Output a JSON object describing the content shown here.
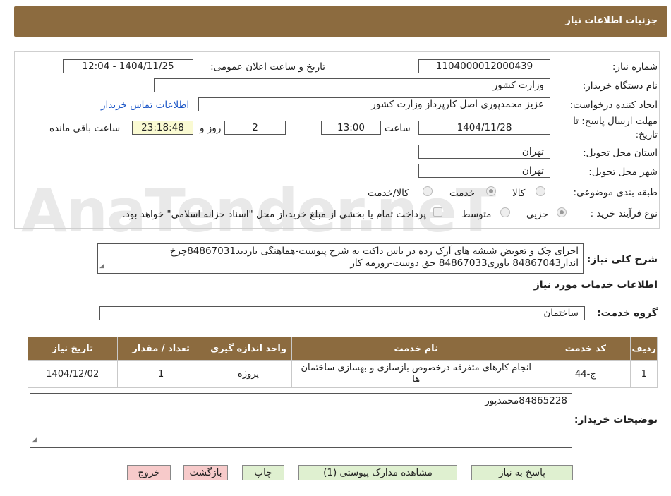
{
  "header": {
    "title": "جزئیات اطلاعات نیاز"
  },
  "watermark": {
    "text": "AnaTender.neT"
  },
  "form": {
    "need_number": {
      "label": "شماره نیاز:",
      "value": "1104000012000439"
    },
    "announce_datetime": {
      "label": "تاریخ و ساعت اعلان عمومی:",
      "value": "1404/11/25 - 12:04"
    },
    "buyer_org": {
      "label": "نام دستگاه خریدار:",
      "value": "وزارت کشور"
    },
    "requester": {
      "label": "ایجاد کننده درخواست:",
      "value": "عزیز محمدپوری اصل کارپرداز وزارت کشور"
    },
    "buyer_contact_link": "اطلاعات تماس خریدار",
    "deadline": {
      "label_line1": "مهلت ارسال پاسخ: تا",
      "label_line2": "تاریخ:",
      "date": "1404/11/28",
      "time_label": "ساعت",
      "time": "13:00",
      "days": "2",
      "days_label": "روز و",
      "remaining": "23:18:48",
      "remaining_label": "ساعت باقی مانده"
    },
    "province": {
      "label": "استان محل تحویل:",
      "value": "تهران"
    },
    "city": {
      "label": "شهر محل تحویل:",
      "value": "تهران"
    },
    "category": {
      "label": "طبقه بندی موضوعی:",
      "options": [
        "کالا",
        "خدمت",
        "کالا/خدمت"
      ],
      "selected": "خدمت"
    },
    "process": {
      "label": "نوع فرآیند خرید :",
      "options": [
        "جزیی",
        "متوسط"
      ],
      "selected": "جزیی",
      "note": "پرداخت تمام یا بخشی از مبلغ خرید،از محل \"اسناد خزانه اسلامی\" خواهد بود."
    },
    "description": {
      "label": "شرح کلی نیاز:",
      "line1": "اجرای چک و تعویض شیشه های آرک زده در باس داکت به شرح پیوست-هماهنگی بازدید84867031چرخ",
      "line2": "انداز84867043 یاوری84867033 حق دوست-روزمه کار"
    }
  },
  "services": {
    "section_title": "اطلاعات خدمات مورد نیاز",
    "group_label": "گروه خدمت:",
    "group_value": "ساختمان",
    "columns": [
      "ردیف",
      "کد خدمت",
      "نام خدمت",
      "واحد اندازه گیری",
      "تعداد / مقدار",
      "تاریخ نیاز"
    ],
    "rows": [
      {
        "index": "1",
        "code": "ج-44",
        "name": "انجام کارهای متفرقه درخصوص بازسازی و بهسازی ساختمان ها",
        "unit": "پروژه",
        "qty": "1",
        "date": "1404/12/02"
      }
    ]
  },
  "buyer_notes": {
    "label": "توضیحات خریدار:",
    "value": "84865228محمدپور"
  },
  "buttons": {
    "reply": "پاسخ به نیاز",
    "attachments": "مشاهده مدارک پیوستی (1)",
    "print": "چاپ",
    "back": "بازگشت",
    "exit": "خروج"
  },
  "colors": {
    "header_bg": "#8c6b3f",
    "link": "#1a55c7",
    "green_button": "#dff0d0",
    "red_button": "#f7caca"
  }
}
